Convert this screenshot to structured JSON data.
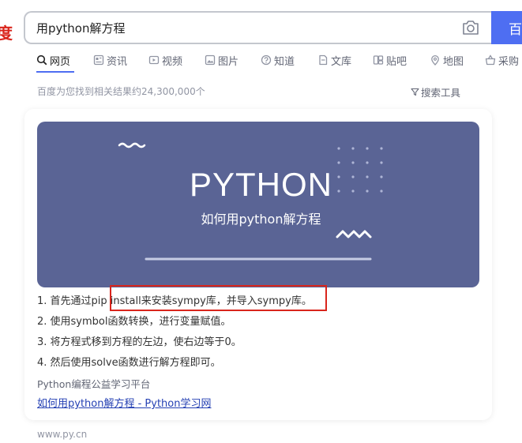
{
  "logo_fragment": "度",
  "search": {
    "query": "用python解方程",
    "button_label": "百"
  },
  "tabs": [
    {
      "label": "网页",
      "icon": "search-icon",
      "active": true
    },
    {
      "label": "资讯",
      "icon": "news-icon"
    },
    {
      "label": "视频",
      "icon": "video-icon"
    },
    {
      "label": "图片",
      "icon": "image-icon"
    },
    {
      "label": "知道",
      "icon": "question-icon"
    },
    {
      "label": "文库",
      "icon": "document-icon"
    },
    {
      "label": "贴吧",
      "icon": "tieba-icon"
    },
    {
      "label": "地图",
      "icon": "map-pin-icon"
    },
    {
      "label": "采购",
      "icon": "basket-icon"
    }
  ],
  "result_stats": "百度为您找到相关结果约24,300,000个",
  "search_tools_label": "搜索工具",
  "result": {
    "banner": {
      "title": "PYTHON",
      "subtitle": "如何用python解方程"
    },
    "steps": [
      "1. 首先通过pip install来安装sympy库，并导入sympy库。",
      "2. 使用symbol函数转换，进行变量赋值。",
      "3. 将方程式移到方程的左边，使右边等于0。",
      "4. 然后使用solve函数进行解方程即可。"
    ],
    "source": "Python编程公益学习平台",
    "link_text": "如何用python解方程 - Python学习网",
    "domain": "www.py.cn"
  },
  "colors": {
    "brand_blue": "#4e6ef2",
    "banner_bg": "#5a6495",
    "highlight_red": "#d9251c",
    "link_blue": "#2440b3"
  }
}
